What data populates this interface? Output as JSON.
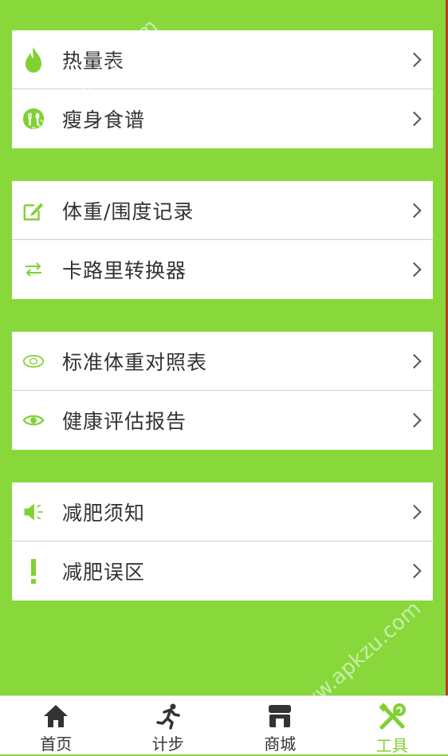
{
  "groups": [
    {
      "items": [
        {
          "label": "热量表",
          "icon": "flame-icon"
        },
        {
          "label": "瘦身食谱",
          "icon": "cutlery-icon"
        }
      ]
    },
    {
      "items": [
        {
          "label": "体重/围度记录",
          "icon": "edit-icon"
        },
        {
          "label": "卡路里转换器",
          "icon": "swap-arrows-icon"
        }
      ]
    },
    {
      "items": [
        {
          "label": "标准体重对照表",
          "icon": "tape-measure-icon"
        },
        {
          "label": "健康评估报告",
          "icon": "eye-icon"
        }
      ]
    },
    {
      "items": [
        {
          "label": "减肥须知",
          "icon": "speaker-icon"
        },
        {
          "label": "减肥误区",
          "icon": "exclamation-icon"
        }
      ]
    }
  ],
  "tabbar": {
    "tabs": [
      {
        "label": "首页",
        "icon": "home-icon"
      },
      {
        "label": "计步",
        "icon": "running-icon"
      },
      {
        "label": "商城",
        "icon": "shop-icon"
      },
      {
        "label": "工具",
        "icon": "tools-icon"
      }
    ],
    "active_index": 3
  },
  "watermark": "www.apkzu.com",
  "colors": {
    "accent": "#7fd133",
    "background": "#88d83c",
    "text": "#333333"
  }
}
